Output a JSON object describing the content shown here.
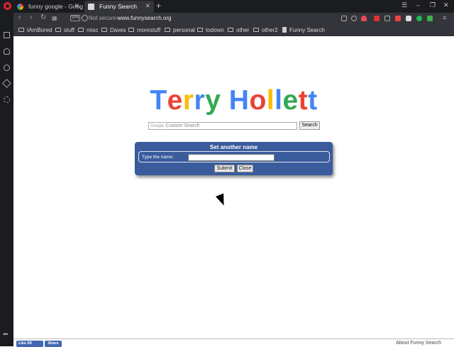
{
  "browser": {
    "tabs": [
      {
        "title": "funny google - Googl",
        "active": false
      },
      {
        "title": "Funny Search",
        "active": true
      }
    ],
    "new_tab_symbol": "+",
    "security_label": "Not secure",
    "vpn_label": "VPN",
    "url": "www.funnysearch.org"
  },
  "bookmarks": [
    {
      "label": "IAmBored",
      "icon": "folder-icon"
    },
    {
      "label": "stuff",
      "icon": "folder-icon"
    },
    {
      "label": "misc",
      "icon": "folder-icon"
    },
    {
      "label": "Daves",
      "icon": "folder-icon"
    },
    {
      "label": "morestuff",
      "icon": "folder-icon"
    },
    {
      "label": "personal",
      "icon": "folder-icon"
    },
    {
      "label": "todown",
      "icon": "folder-icon"
    },
    {
      "label": "other",
      "icon": "folder-icon"
    },
    {
      "label": "other2",
      "icon": "folder-icon"
    },
    {
      "label": "Funny Search",
      "icon": "page-icon"
    }
  ],
  "page": {
    "logo_letters": [
      {
        "ch": "T",
        "color": "#4285f4"
      },
      {
        "ch": "e",
        "color": "#ea4335"
      },
      {
        "ch": "r",
        "color": "#fbbc05"
      },
      {
        "ch": "r",
        "color": "#4285f4"
      },
      {
        "ch": "y",
        "color": "#34a853"
      },
      {
        "ch": " ",
        "color": "#000000"
      },
      {
        "ch": "H",
        "color": "#4285f4"
      },
      {
        "ch": "o",
        "color": "#ea4335"
      },
      {
        "ch": "l",
        "color": "#fbbc05"
      },
      {
        "ch": "l",
        "color": "#4285f4"
      },
      {
        "ch": "e",
        "color": "#34a853"
      },
      {
        "ch": "t",
        "color": "#ea4335"
      },
      {
        "ch": "t",
        "color": "#4285f4"
      }
    ],
    "search_prefix": "Google",
    "search_placeholder": "Custom Search",
    "search_button": "Search",
    "dialog": {
      "title": "Set another name",
      "label": "Type the name:",
      "input_value": "",
      "submit": "Submit",
      "close": "Close"
    },
    "footer": {
      "like": "Like 5K",
      "share": "Share",
      "about": "About Funny Search"
    }
  }
}
